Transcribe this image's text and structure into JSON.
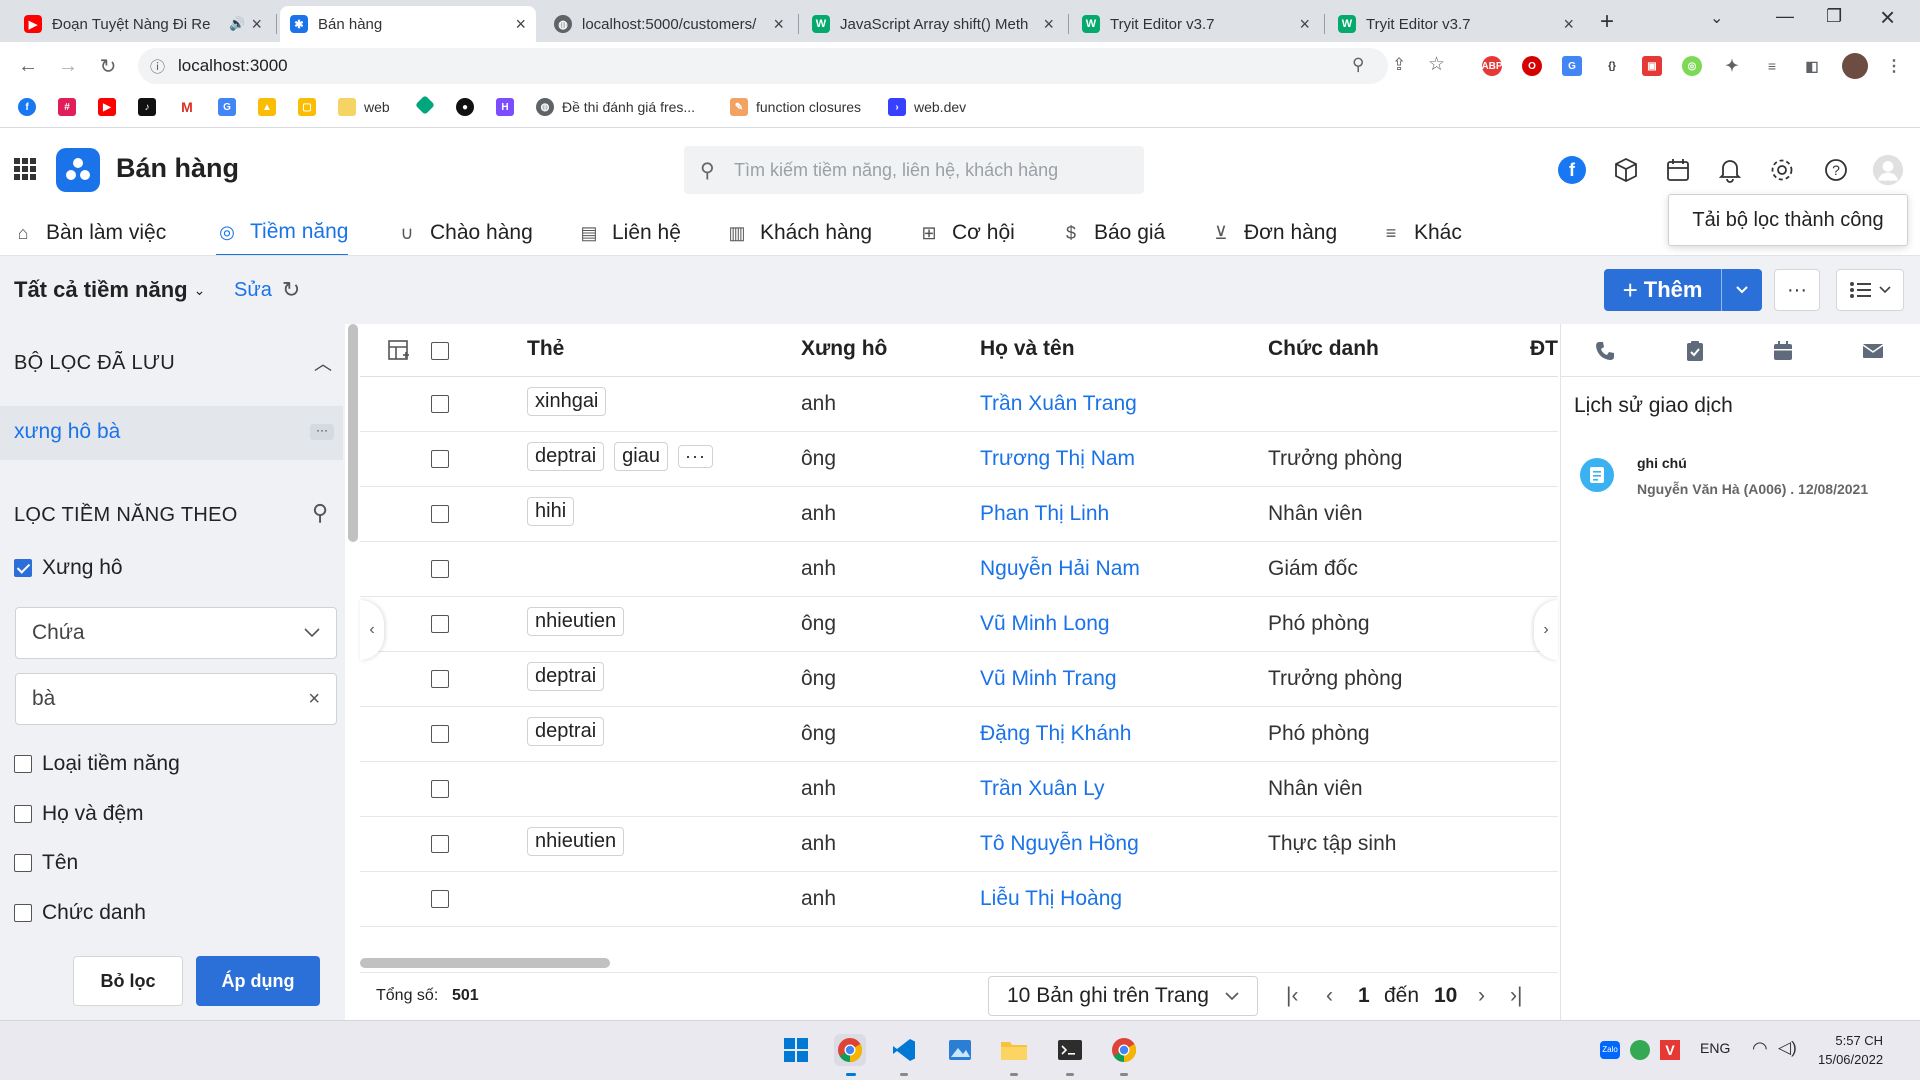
{
  "browser": {
    "tabs": [
      {
        "title": "Đoạn Tuyệt Nàng Đi Re",
        "icon": "youtube-icon",
        "active": false
      },
      {
        "title": "Bán hàng",
        "icon": "app-icon",
        "active": true
      },
      {
        "title": "localhost:5000/customers/",
        "icon": "globe-icon",
        "active": false
      },
      {
        "title": "JavaScript Array shift() Meth",
        "icon": "w3schools-icon",
        "active": false
      },
      {
        "title": "Tryit Editor v3.7",
        "icon": "w3schools-icon",
        "active": false
      },
      {
        "title": "Tryit Editor v3.7",
        "icon": "w3schools-icon",
        "active": false
      }
    ],
    "url": "localhost:3000",
    "bookmarks": [
      {
        "label": "",
        "icon": "facebook-icon"
      },
      {
        "label": "",
        "icon": "slack-icon"
      },
      {
        "label": "",
        "icon": "youtube-icon"
      },
      {
        "label": "",
        "icon": "tiktok-icon"
      },
      {
        "label": "",
        "icon": "gmail-icon"
      },
      {
        "label": "",
        "icon": "translate-icon"
      },
      {
        "label": "",
        "icon": "drive-icon"
      },
      {
        "label": "",
        "icon": "keep-icon"
      },
      {
        "label": "web",
        "icon": "folder-icon"
      },
      {
        "label": "",
        "icon": "diamond-icon"
      },
      {
        "label": "",
        "icon": "circle-icon"
      },
      {
        "label": "",
        "icon": "h-icon"
      },
      {
        "label": "Đề thi đánh giá fres...",
        "icon": "globe-icon"
      },
      {
        "label": "function closures",
        "icon": "bookmark-icon"
      },
      {
        "label": "web.dev",
        "icon": "webdev-icon"
      }
    ]
  },
  "app": {
    "title": "Bán hàng",
    "search_placeholder": "Tìm kiếm tiềm năng, liên hệ, khách hàng",
    "toast": "Tải bộ lọc thành công",
    "nav": [
      {
        "label": "Bàn làm việc",
        "icon": "home-icon",
        "active": false
      },
      {
        "label": "Tiềm năng",
        "icon": "user-circle-icon",
        "active": true
      },
      {
        "label": "Chào hàng",
        "icon": "magnet-icon",
        "active": false
      },
      {
        "label": "Liên hệ",
        "icon": "contact-icon",
        "active": false
      },
      {
        "label": "Khách hàng",
        "icon": "building-icon",
        "active": false
      },
      {
        "label": "Cơ hội",
        "icon": "briefcase-icon",
        "active": false
      },
      {
        "label": "Báo giá",
        "icon": "quote-icon",
        "active": false
      },
      {
        "label": "Đơn hàng",
        "icon": "cart-icon",
        "active": false
      },
      {
        "label": "Khác",
        "icon": "menu-icon",
        "active": false
      }
    ]
  },
  "toolbar": {
    "view_title": "Tất cả tiềm năng",
    "edit_label": "Sửa",
    "add_label": "Thêm"
  },
  "filters": {
    "saved_heading": "BỘ LỌC ĐÃ LƯU",
    "saved_item": "xưng hô bà",
    "filter_heading": "LỌC TIỀM NĂNG THEO",
    "fields": [
      {
        "label": "Xưng hô",
        "checked": true
      },
      {
        "label": "Loại tiềm năng",
        "checked": false
      },
      {
        "label": "Họ và đệm",
        "checked": false
      },
      {
        "label": "Tên",
        "checked": false
      },
      {
        "label": "Chức danh",
        "checked": false
      }
    ],
    "condition": "Chứa",
    "value": "bà",
    "reset_label": "Bỏ lọc",
    "apply_label": "Áp dụng"
  },
  "table": {
    "columns": [
      "Thẻ",
      "Xưng hô",
      "Họ và tên",
      "Chức danh",
      "ĐT"
    ],
    "rows": [
      {
        "tags": [
          "xinhgai"
        ],
        "more": false,
        "salutation": "anh",
        "name": "Trần Xuân Trang",
        "title": ""
      },
      {
        "tags": [
          "deptrai",
          "giau"
        ],
        "more": true,
        "salutation": "ông",
        "name": "Trương Thị Nam",
        "title": "Trưởng phòng"
      },
      {
        "tags": [
          "hihi"
        ],
        "more": false,
        "salutation": "anh",
        "name": "Phan Thị Linh",
        "title": "Nhân viên"
      },
      {
        "tags": [],
        "more": false,
        "salutation": "anh",
        "name": "Nguyễn Hải Nam",
        "title": "Giám đốc"
      },
      {
        "tags": [
          "nhieutien"
        ],
        "more": false,
        "salutation": "ông",
        "name": "Vũ Minh Long",
        "title": "Phó phòng"
      },
      {
        "tags": [
          "deptrai"
        ],
        "more": false,
        "salutation": "ông",
        "name": "Vũ Minh Trang",
        "title": "Trưởng phòng"
      },
      {
        "tags": [
          "deptrai"
        ],
        "more": false,
        "salutation": "ông",
        "name": "Đặng Thị Khánh",
        "title": "Phó phòng"
      },
      {
        "tags": [],
        "more": false,
        "salutation": "anh",
        "name": "Trần Xuân Ly",
        "title": "Nhân viên"
      },
      {
        "tags": [
          "nhieutien"
        ],
        "more": false,
        "salutation": "anh",
        "name": "Tô Nguyễn Hồng",
        "title": "Thực tập sinh"
      },
      {
        "tags": [],
        "more": false,
        "salutation": "anh",
        "name": "Liễu Thị Hoàng",
        "title": ""
      }
    ],
    "total_label": "Tổng số:",
    "total": "501",
    "page_size": "10 Bản ghi trên Trang",
    "page_from": "1",
    "page_to_label": "đến",
    "page_to": "10"
  },
  "history": {
    "title": "Lịch sử giao dịch",
    "items": [
      {
        "type": "ghi chú",
        "meta": "Nguyễn Văn Hà (A006) . 12/08/2021"
      }
    ]
  },
  "taskbar": {
    "language": "ENG",
    "time": "5:57 CH",
    "date": "15/06/2022"
  },
  "colors": {
    "accent": "#1a73e8",
    "primary_button": "#2b6fd9",
    "phone_green": "#21a366",
    "panel_bg": "#f0f1f4"
  }
}
